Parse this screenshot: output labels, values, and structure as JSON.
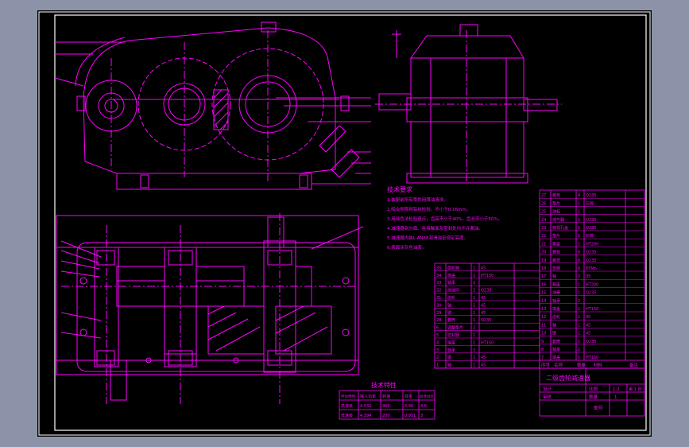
{
  "drawing": {
    "tech_req_title": "技术要求",
    "tech_req_lines": [
      "1.装配前所有零件用煤油清洗。",
      "2.啮合侧隙用铅丝检验，不小于0.16mm。",
      "3.用涂色法检验斑点，齿高不小于40%，齿长不小于50%。",
      "4.减速器剖分面、各接触面及密封处均不许漏油。",
      "5.减速器内装L-AN68润滑油至规定高度。",
      "6.表面涂灰色油漆。"
    ],
    "tech_char_title": "技术特性",
    "tech_char_headers": [
      "输入功率",
      "转速",
      "效率",
      "总传动比",
      "传动特性"
    ],
    "tech_char_rows": [
      [
        "高速级",
        "4.532",
        "960",
        "0.96",
        "4.8"
      ],
      [
        "低速级",
        "4.394",
        "200",
        "0.951",
        "3"
      ]
    ],
    "title_block": {
      "name": "二级齿轮减速器",
      "scale_label": "比例",
      "scale": "1:1",
      "qty_label": "数量",
      "qty": "1",
      "sheet": "第 1 张",
      "designer": "设计",
      "checker": "审核",
      "drawing_no": "图号"
    },
    "bom_right": [
      [
        "27",
        "螺栓",
        "4",
        "Q235"
      ],
      [
        "26",
        "垫片",
        "1",
        "石棉"
      ],
      [
        "25",
        "油标",
        "1",
        ""
      ],
      [
        "24",
        "通气器",
        "1",
        "Q235"
      ],
      [
        "23",
        "窥视孔盖",
        "1",
        "Q235"
      ],
      [
        "22",
        "垫片",
        "1",
        "石棉"
      ],
      [
        "21",
        "箱盖",
        "1",
        "HT200"
      ],
      [
        "20",
        "螺栓",
        "6",
        "Q235"
      ],
      [
        "19",
        "螺母",
        "6",
        "Q235"
      ],
      [
        "18",
        "垫圈",
        "6",
        "65Mn"
      ],
      [
        "17",
        "销",
        "2",
        "35"
      ],
      [
        "16",
        "箱座",
        "1",
        "HT200"
      ],
      [
        "15",
        "油塞",
        "1",
        "Q235"
      ],
      [
        "14",
        "轴承",
        "2",
        ""
      ],
      [
        "13",
        "端盖",
        "1",
        "HT150"
      ],
      [
        "12",
        "齿轮",
        "1",
        "45"
      ],
      [
        "11",
        "轴",
        "1",
        "45"
      ],
      [
        "10",
        "键",
        "1",
        "45"
      ],
      [
        "9",
        "套筒",
        "1",
        "Q235"
      ],
      [
        "8",
        "轴承",
        "2",
        ""
      ],
      [
        "7",
        "端盖",
        "1",
        "HT150"
      ]
    ],
    "bom_left": [
      [
        "35",
        "齿轮轴",
        "1",
        "45"
      ],
      [
        "34",
        "端盖",
        "1",
        "HT150"
      ],
      [
        "33",
        "轴承",
        "2",
        ""
      ],
      [
        "32",
        "挡油环",
        "2",
        "Q235"
      ],
      [
        "31",
        "齿轮",
        "1",
        "45"
      ],
      [
        "30",
        "轴",
        "1",
        "45"
      ],
      [
        "29",
        "键",
        "1",
        "45"
      ],
      [
        "28",
        "套筒",
        "1",
        "Q235"
      ],
      [
        "6",
        "调整垫片",
        "2",
        ""
      ],
      [
        "5",
        "密封圈",
        "1",
        ""
      ],
      [
        "4",
        "端盖",
        "1",
        "HT150"
      ],
      [
        "3",
        "轴承",
        "2",
        ""
      ],
      [
        "2",
        "键",
        "1",
        "45"
      ],
      [
        "1",
        "轴",
        "1",
        "45"
      ]
    ],
    "bom_headers": [
      "序号",
      "名称",
      "数量",
      "材料",
      "备注"
    ]
  },
  "colors": {
    "line": "#ff00ff",
    "paper": "#000000",
    "frame": "#ffffff",
    "window": "#8c93a8"
  }
}
